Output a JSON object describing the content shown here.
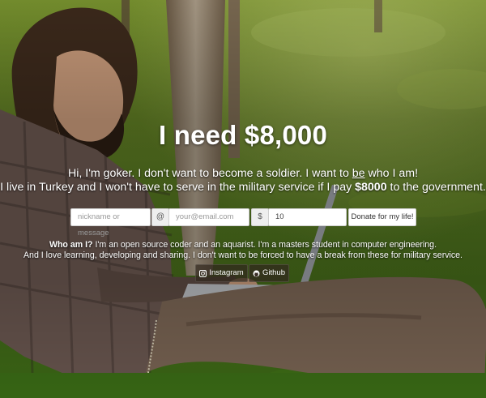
{
  "headline": "I need $8,000",
  "intro": {
    "line1_pre": "Hi, I'm goker. I don't want to become a soldier. I want to ",
    "line1_emph": "be",
    "line1_post": " who I am!",
    "line2_pre": "I live in Turkey and I won't have to serve in the military service if I pay ",
    "line2_amount": "$8000",
    "line2_post": " to the government."
  },
  "form": {
    "nickname_placeholder": "nickname or message",
    "at_symbol": "@",
    "email_placeholder": "your@email.com",
    "currency_symbol": "$",
    "amount_value": "10",
    "donate_label": "Donate for my life!"
  },
  "about": {
    "heading": "Who am I?",
    "line1": " I'm an open source coder and an aquarist. I'm a masters student in computer engineering.",
    "line2": "And I love learning, developing and sharing. I don't want to be forced to have a break from these for military service."
  },
  "social": {
    "instagram_label": "Instagram",
    "github_label": "Github"
  },
  "icons": {
    "instagram": "instagram-icon",
    "github": "github-icon"
  },
  "colors": {
    "text": "#ffffff",
    "grass": "#5d7d22",
    "button_bg": "#ffffff",
    "addon_bg": "#eeeeee"
  }
}
